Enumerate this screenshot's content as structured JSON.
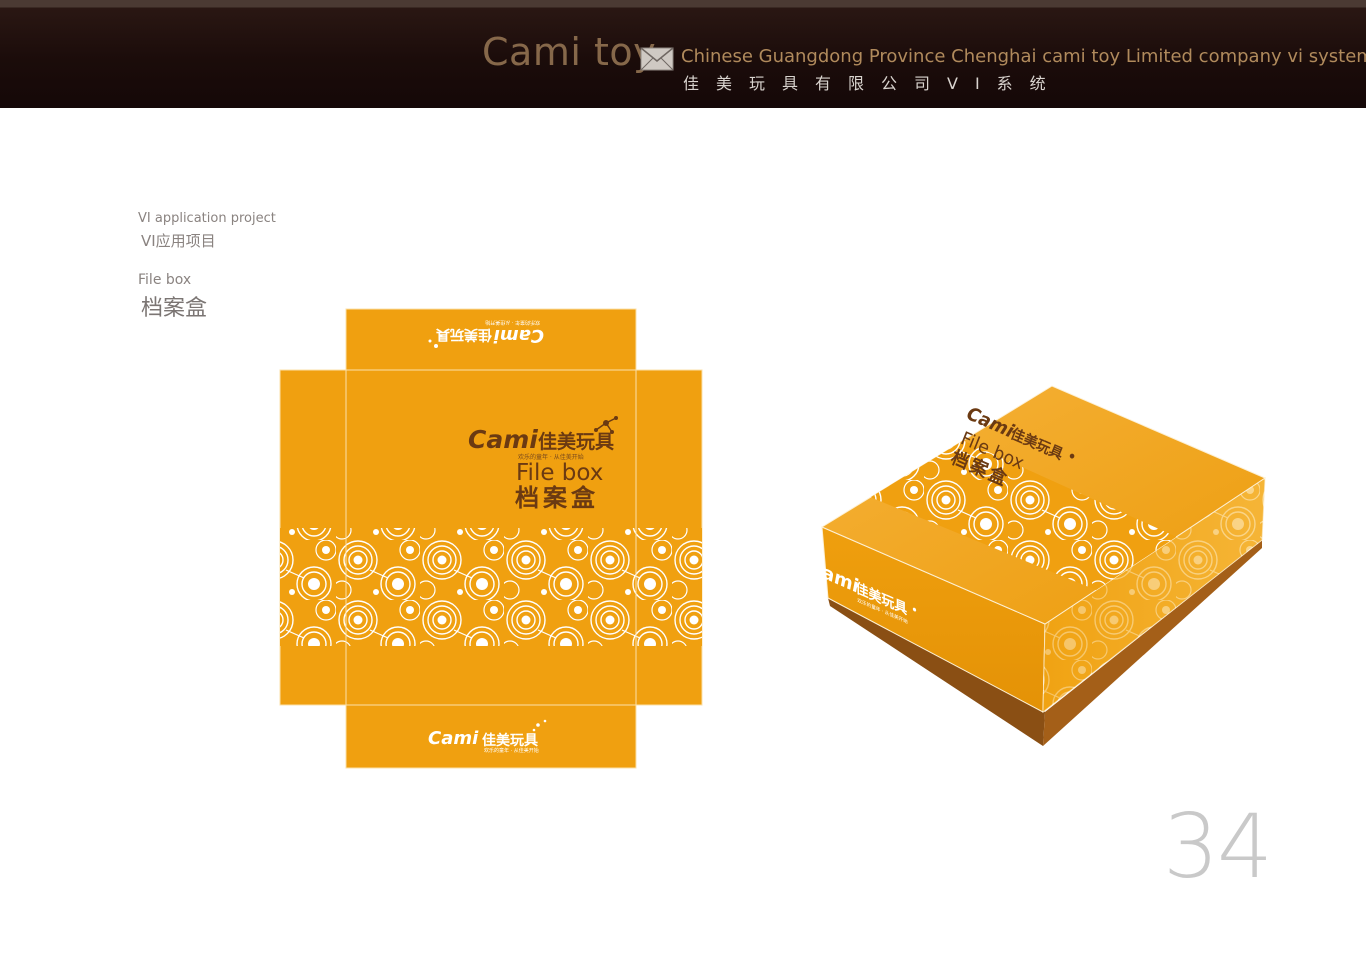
{
  "header": {
    "brand": "Cami toy",
    "title_en": "Chinese Guangdong Province Chenghai cami toy Limited company vi system",
    "title_cn": "佳美玩具有限公司VI系统"
  },
  "section": {
    "category_en": "VI application project",
    "category_cn": "VI应用项目",
    "item_en": "File box",
    "item_cn": "档案盒"
  },
  "box": {
    "logo_word": "Cami",
    "logo_cn": "佳美玩具",
    "tagline": "欢乐的童年 · 从佳美开始",
    "title_en": "File box",
    "title_cn": "档案盒"
  },
  "colors": {
    "box_orange": "#f0a010",
    "logo_brown": "#6b3a12",
    "header_dark": "#1b0c0a",
    "brand_gold": "#86684a"
  },
  "page_number": "34"
}
